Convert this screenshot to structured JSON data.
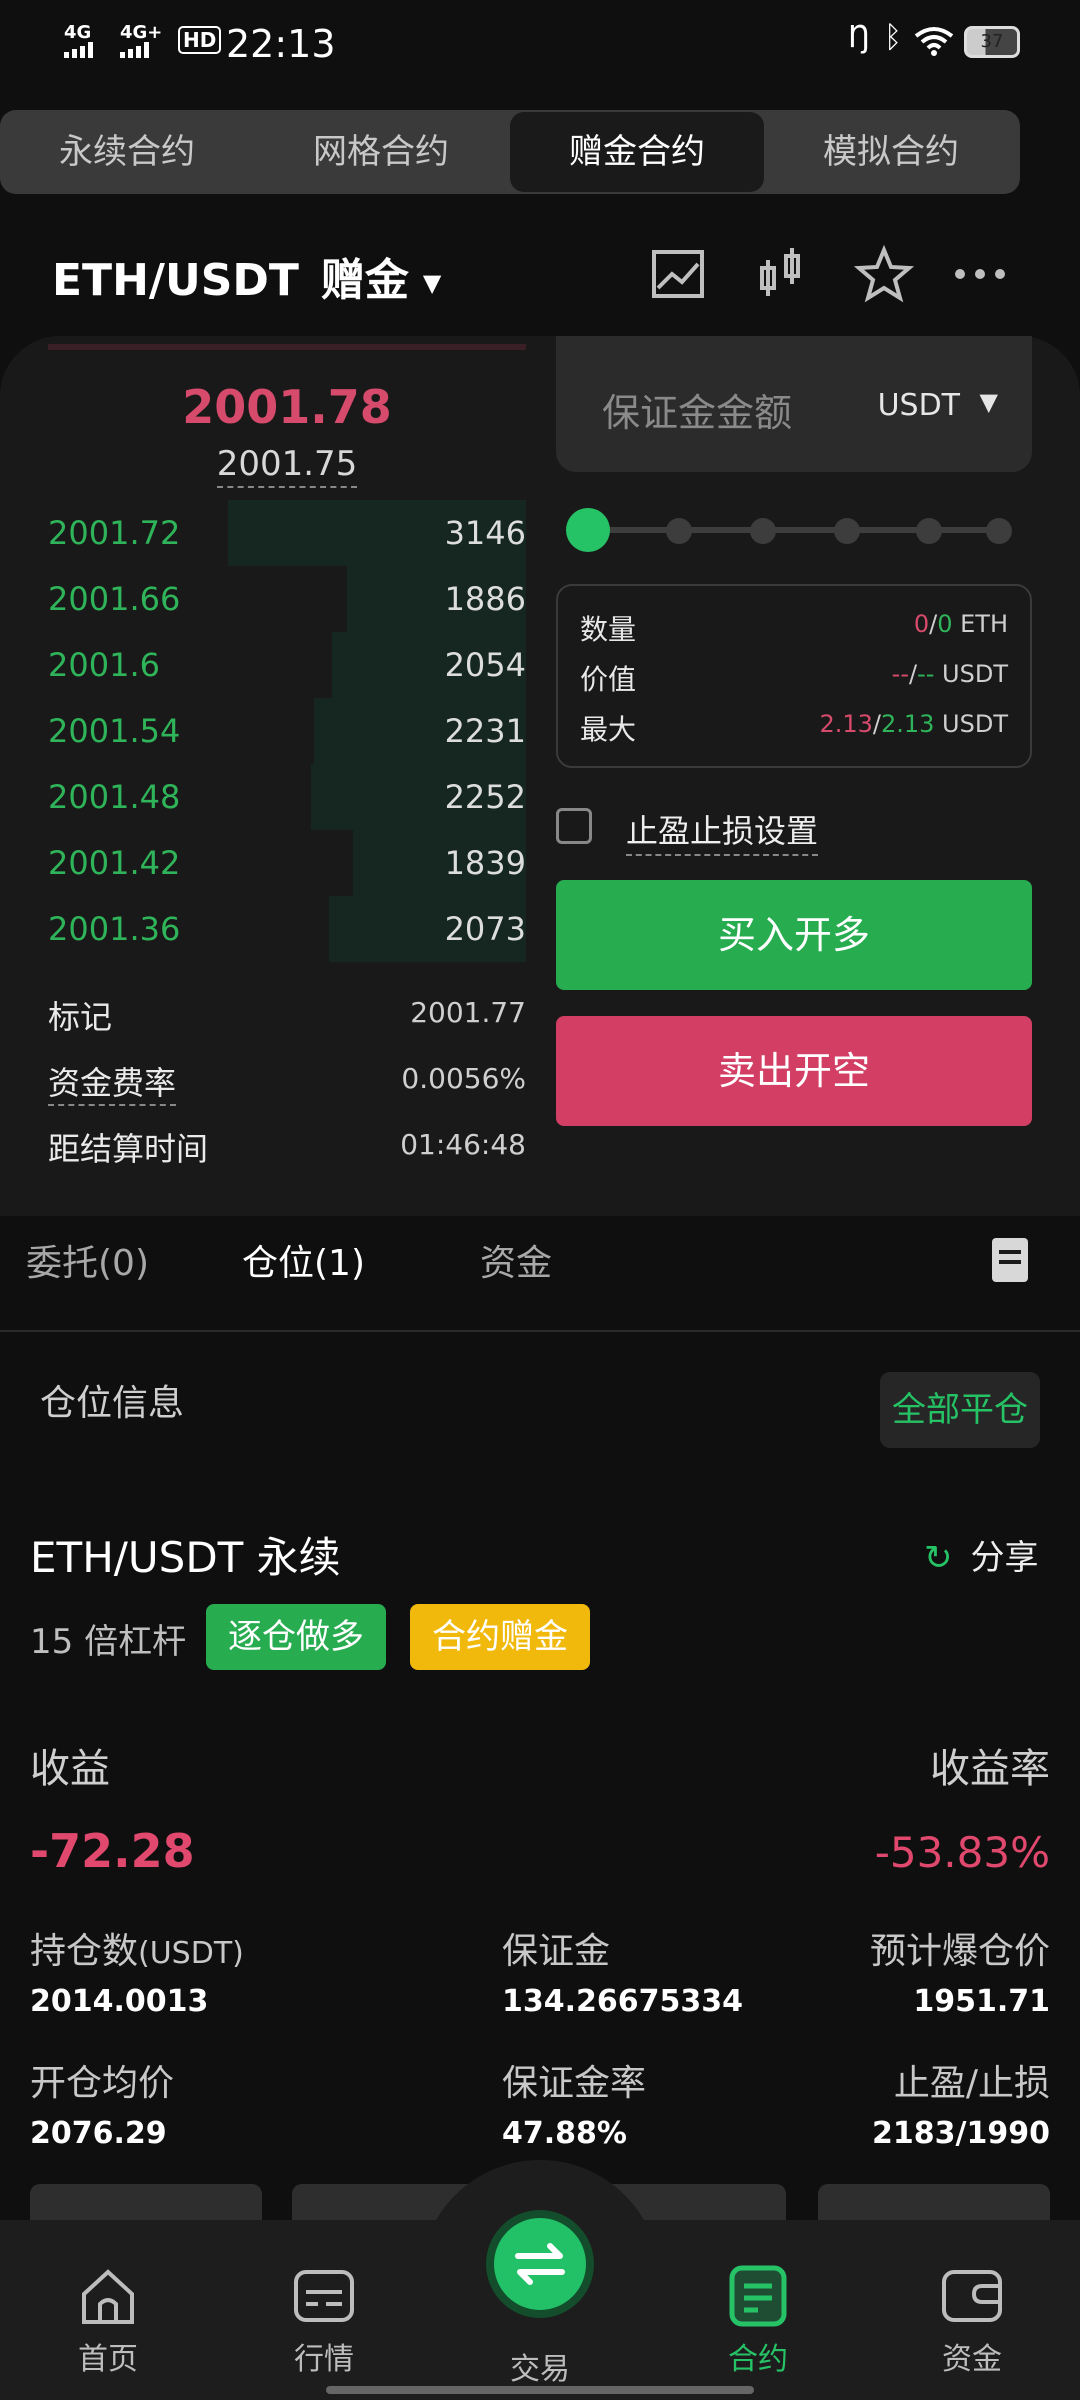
{
  "status_bar": {
    "net1": "4G",
    "net2": "4G+",
    "hd": "HD",
    "time": "22:13",
    "battery": "37"
  },
  "contract_tabs": [
    {
      "label": "永续合约",
      "active": false
    },
    {
      "label": "网格合约",
      "active": false
    },
    {
      "label": "赠金合约",
      "active": true
    },
    {
      "label": "模拟合约",
      "active": false
    }
  ],
  "header": {
    "pair": "ETH/USDT",
    "suffix": "赠金",
    "icons": [
      "chart-icon",
      "candlestick-icon",
      "star-icon",
      "more-icon"
    ]
  },
  "orderbook": {
    "last_price": "2001.78",
    "index_price": "2001.75",
    "bids": [
      {
        "price": "2001.72",
        "qty": "3146",
        "depth": 1.0
      },
      {
        "price": "2001.66",
        "qty": "1886",
        "depth": 0.6
      },
      {
        "price": "2001.6",
        "qty": "2054",
        "depth": 0.65
      },
      {
        "price": "2001.54",
        "qty": "2231",
        "depth": 0.71
      },
      {
        "price": "2001.48",
        "qty": "2252",
        "depth": 0.72
      },
      {
        "price": "2001.42",
        "qty": "1839",
        "depth": 0.58
      },
      {
        "price": "2001.36",
        "qty": "2073",
        "depth": 0.66
      }
    ],
    "mark_label": "标记",
    "mark_value": "2001.77",
    "funding_label": "资金费率",
    "funding_value": "0.0056%",
    "settle_label": "距结算时间",
    "settle_value": "01:46:48"
  },
  "order_form": {
    "margin_placeholder": "保证金金额",
    "unit": "USDT",
    "slider_percent": 0,
    "qty_label": "数量",
    "qty_a": "0",
    "qty_b": "0",
    "qty_unit": "ETH",
    "value_label": "价值",
    "value_a": "--",
    "value_b": "--",
    "value_unit": "USDT",
    "max_label": "最大",
    "max_a": "2.13",
    "max_b": "2.13",
    "max_unit": "USDT",
    "tpsl_label": "止盈止损设置",
    "buy_label": "买入开多",
    "sell_label": "卖出开空"
  },
  "section_tabs": {
    "orders": "委托(0)",
    "positions": "仓位(1)",
    "funds": "资金"
  },
  "position": {
    "title": "仓位信息",
    "close_all": "全部平仓",
    "symbol": "ETH/USDT 永续",
    "share": "分享",
    "leverage": "15 倍杠杆",
    "tag1": "逐仓做多",
    "tag2": "合约赠金",
    "pnl_label": "收益",
    "pnl_rate_label": "收益率",
    "pnl": "-72.28",
    "pnl_rate": "-53.83%",
    "size_label": "持仓数",
    "size_unit": "(USDT)",
    "size": "2014.0013",
    "margin_label": "保证金",
    "margin": "134.26675334",
    "liq_label": "预计爆仓价",
    "liq": "1951.71",
    "entry_label": "开仓均价",
    "entry": "2076.29",
    "margin_rate_label": "保证金率",
    "margin_rate": "47.88%",
    "tpsl_label": "止盈/止损",
    "tpsl": "2183/1990"
  },
  "nav": [
    {
      "label": "首页",
      "icon": "home-icon"
    },
    {
      "label": "行情",
      "icon": "market-icon"
    },
    {
      "label": "交易",
      "icon": "swap-icon"
    },
    {
      "label": "合约",
      "icon": "contract-icon",
      "active": true
    },
    {
      "label": "资金",
      "icon": "wallet-icon"
    }
  ],
  "colors": {
    "green": "#26c266",
    "red": "#d33e64",
    "gold": "#f0b90b"
  }
}
